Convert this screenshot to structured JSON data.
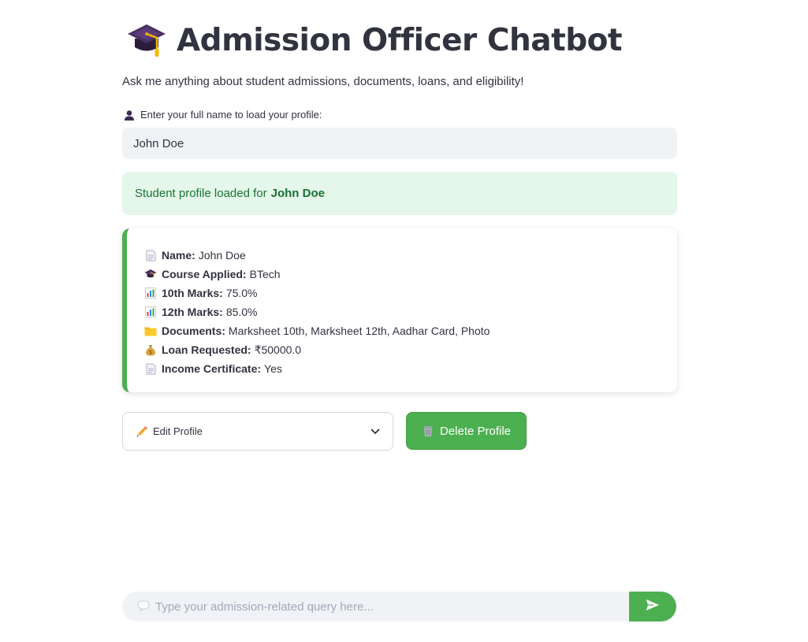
{
  "header": {
    "title": "Admission Officer Chatbot",
    "title_icon": "graduation-cap-icon",
    "subtitle": "Ask me anything about student admissions, documents, loans, and eligibility!"
  },
  "name_input": {
    "label": "Enter your full name to load your profile:",
    "label_icon": "user-silhouette-icon",
    "value": "John Doe"
  },
  "alert": {
    "prefix": "Student profile loaded for",
    "name": "John Doe"
  },
  "profile": {
    "rows": [
      {
        "icon": "page-icon",
        "label": "Name:",
        "value": "John Doe"
      },
      {
        "icon": "graduation-cap-icon",
        "label": "Course Applied:",
        "value": "BTech"
      },
      {
        "icon": "bar-chart-icon",
        "label": "10th Marks:",
        "value": "75.0%"
      },
      {
        "icon": "bar-chart-icon",
        "label": "12th Marks:",
        "value": "85.0%"
      },
      {
        "icon": "folder-icon",
        "label": "Documents:",
        "value": "Marksheet 10th, Marksheet 12th, Aadhar Card, Photo"
      },
      {
        "icon": "money-bag-icon",
        "label": "Loan Requested:",
        "value": "₹50000.0"
      },
      {
        "icon": "page-icon",
        "label": "Income Certificate:",
        "value": "Yes"
      }
    ]
  },
  "actions": {
    "edit_label": "Edit Profile",
    "delete_label": "Delete Profile"
  },
  "chat": {
    "placeholder": "Type your admission-related query here..."
  },
  "colors": {
    "accent": "#4caf50",
    "success_bg": "#e5f7ea",
    "success_text": "#177233",
    "input_bg": "#f0f2f6",
    "text": "#31333f"
  }
}
